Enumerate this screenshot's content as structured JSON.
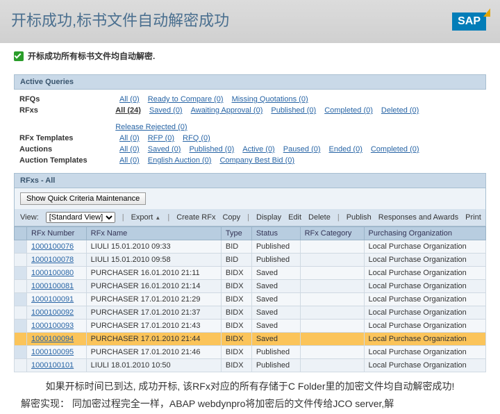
{
  "header": {
    "title": "开标成功,标书文件自动解密成功",
    "logo": "SAP"
  },
  "check": {
    "label": "开标成功所有标书文件均自动解密."
  },
  "activeQueries": {
    "title": "Active Queries",
    "rows": [
      {
        "label": "RFQs",
        "links": [
          "All (0)",
          "Ready to Compare (0)",
          "Missing Quotations (0)"
        ]
      },
      {
        "label": "RFxs",
        "links": [
          "All (24)",
          "Saved (0)",
          "Awaiting Approval (0)",
          "Published (0)",
          "Completed (0)",
          "Deleted (0)",
          "Release Rejected (0)"
        ],
        "activeIndex": 0
      },
      {
        "label": "RFx Templates",
        "links": [
          "All (0)",
          "RFP (0)",
          "RFQ (0)"
        ]
      },
      {
        "label": "Auctions",
        "links": [
          "All (0)",
          "Saved (0)",
          "Published (0)",
          "Active (0)",
          "Paused (0)",
          "Ended (0)",
          "Completed (0)"
        ]
      },
      {
        "label": "Auction Templates",
        "links": [
          "All (0)",
          "English Auction (0)",
          "Company Best Bid (0)"
        ]
      }
    ]
  },
  "listTitle": "RFxs - All",
  "criteriaBtn": "Show Quick Criteria Maintenance",
  "toolbar": {
    "viewLabel": "View:",
    "viewOption": "[Standard View]",
    "export": "Export",
    "createRfx": "Create RFx",
    "copy": "Copy",
    "display": "Display",
    "edit": "Edit",
    "delete": "Delete",
    "publish": "Publish",
    "responses": "Responses and Awards",
    "print": "Print"
  },
  "columns": [
    "RFx Number",
    "RFx Name",
    "Type",
    "Status",
    "RFx Category",
    "Purchasing Organization"
  ],
  "rows": [
    {
      "num": "1000100076",
      "name": "LIULI 15.01.2010 09:33",
      "type": "BID",
      "status": "Published",
      "cat": "",
      "org": "Local Purchase Organization"
    },
    {
      "num": "1000100078",
      "name": "LIULI 15.01.2010 09:58",
      "type": "BID",
      "status": "Published",
      "cat": "",
      "org": "Local Purchase Organization"
    },
    {
      "num": "1000100080",
      "name": "PURCHASER 16.01.2010 21:11",
      "type": "BIDX",
      "status": "Saved",
      "cat": "",
      "org": "Local Purchase Organization"
    },
    {
      "num": "1000100081",
      "name": "PURCHASER 16.01.2010 21:14",
      "type": "BIDX",
      "status": "Saved",
      "cat": "",
      "org": "Local Purchase Organization"
    },
    {
      "num": "1000100091",
      "name": "PURCHASER 17.01.2010 21:29",
      "type": "BIDX",
      "status": "Saved",
      "cat": "",
      "org": "Local Purchase Organization"
    },
    {
      "num": "1000100092",
      "name": "PURCHASER 17.01.2010 21:37",
      "type": "BIDX",
      "status": "Saved",
      "cat": "",
      "org": "Local Purchase Organization"
    },
    {
      "num": "1000100093",
      "name": "PURCHASER 17.01.2010 21:43",
      "type": "BIDX",
      "status": "Saved",
      "cat": "",
      "org": "Local Purchase Organization"
    },
    {
      "num": "1000100094",
      "name": "PURCHASER 17.01.2010 21:44",
      "type": "BIDX",
      "status": "Saved",
      "cat": "",
      "org": "Local Purchase Organization",
      "highlight": true
    },
    {
      "num": "1000100095",
      "name": "PURCHASER 17.01.2010 21:46",
      "type": "BIDX",
      "status": "Published",
      "cat": "",
      "org": "Local Purchase Organization"
    },
    {
      "num": "1000100101",
      "name": "LIULI 18.01.2010 10:50",
      "type": "BIDX",
      "status": "Published",
      "cat": "",
      "org": "Local Purchase Organization"
    }
  ],
  "footer1": "如果开标时间已到达, 成功开标, 该RFx对应的所有存储于C Folder里的加密文件均自动解密成功!",
  "footer2": "解密实现： 同加密过程完全一样，ABAP webdynpro将加密后的文件传给JCO server,解"
}
